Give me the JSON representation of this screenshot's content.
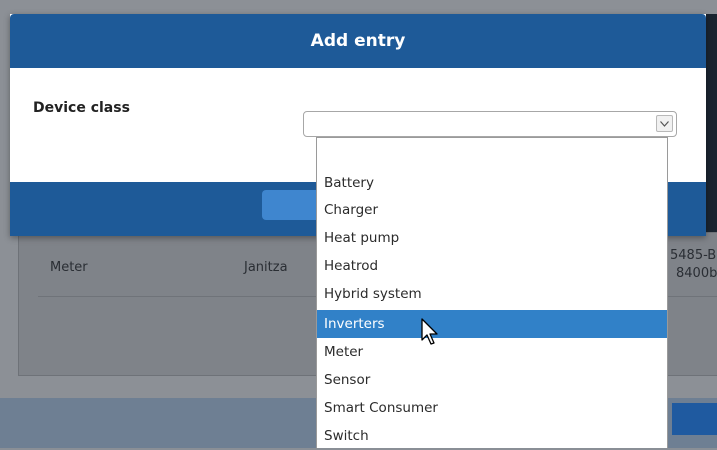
{
  "modal": {
    "title": "Add entry",
    "device_class_label": "Device class",
    "device_class_value": ""
  },
  "dropdown": {
    "options": [
      {
        "label": "",
        "selected": false
      },
      {
        "label": "Battery",
        "selected": false
      },
      {
        "label": "Charger",
        "selected": false
      },
      {
        "label": "Heat pump",
        "selected": false
      },
      {
        "label": "Heatrod",
        "selected": false
      },
      {
        "label": "Hybrid system",
        "selected": false
      },
      {
        "label": "Inverters",
        "selected": true
      },
      {
        "label": "Meter",
        "selected": false
      },
      {
        "label": "Sensor",
        "selected": false
      },
      {
        "label": "Smart Consumer",
        "selected": false
      },
      {
        "label": "Switch",
        "selected": false
      }
    ]
  },
  "background_table": {
    "row": {
      "type": "Meter",
      "manufacturer": "Janitza",
      "model_partial_1": "5485-B",
      "model_partial_2": "8400b"
    }
  },
  "colors": {
    "header_blue": "#1e5a98",
    "selected_option": "#3181c8"
  },
  "icons": {
    "select_arrow": "chevron-down-icon",
    "cursor": "mouse-pointer-icon"
  }
}
